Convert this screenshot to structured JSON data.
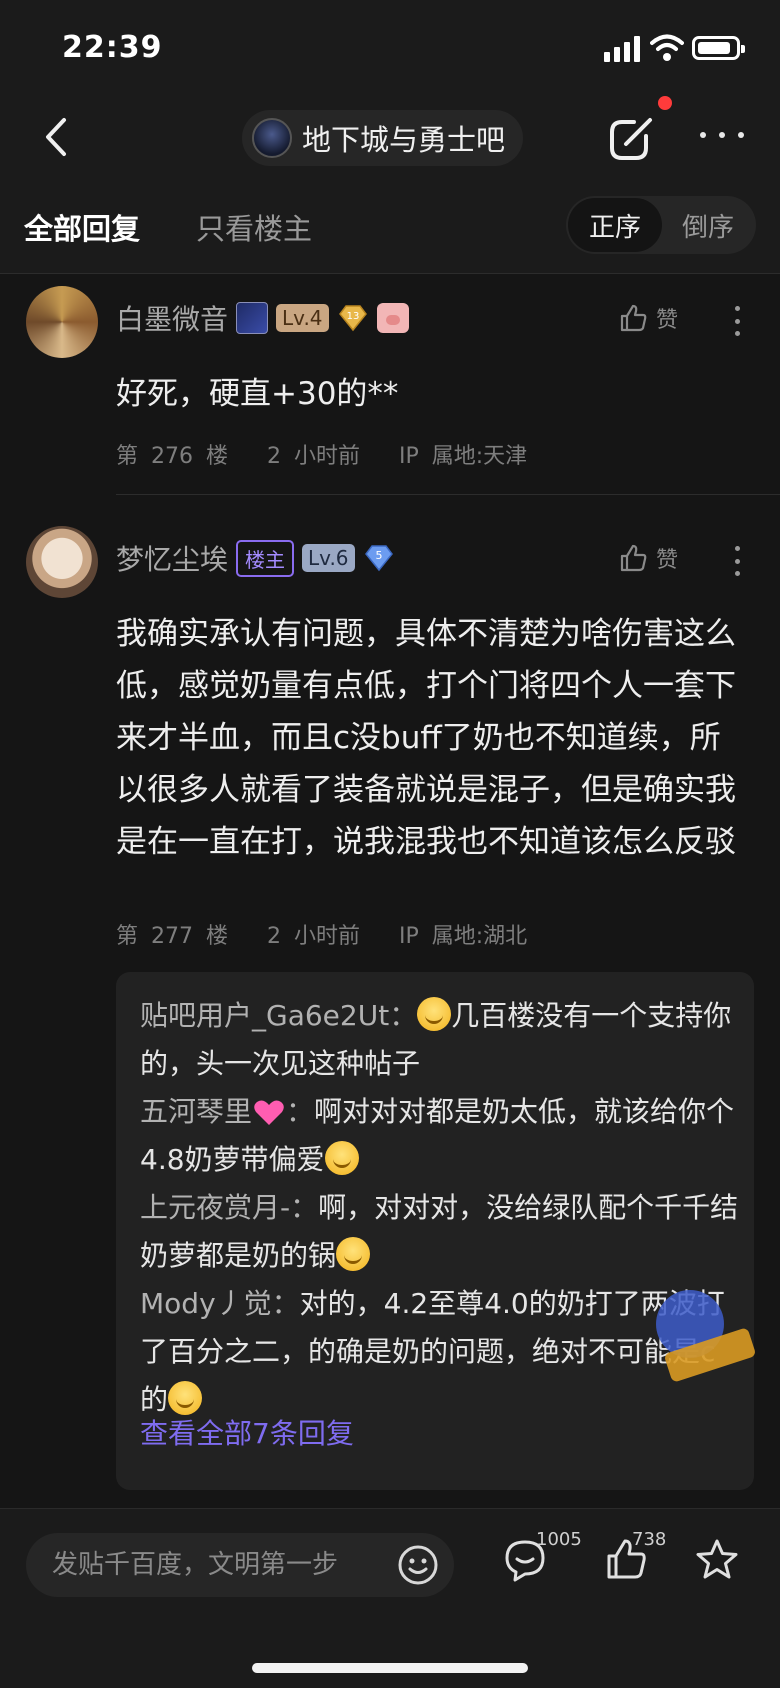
{
  "status_bar": {
    "time": "22:39"
  },
  "nav": {
    "forum_name": "地下城与勇士吧"
  },
  "tabs": {
    "all": "全部回复",
    "op_only": "只看楼主",
    "order_asc": "正序",
    "order_desc": "倒序"
  },
  "posts": [
    {
      "username": "白墨微音",
      "level": "Lv.4",
      "gem_level": "13",
      "content": "好死，硬直+30的**",
      "floor": "第 276 楼",
      "time": "2 小时前",
      "ip": "IP 属地:天津",
      "like_label": "赞"
    },
    {
      "username": "梦忆尘埃",
      "op_badge": "楼主",
      "level": "Lv.6",
      "gem_level": "5",
      "content": "我确实承认有问题，具体不清楚为啥伤害这么低，感觉奶量有点低，打个门将四个人一套下来才半血，而且c没buff了奶也不知道续，所以很多人就看了装备就说是混子，但是确实我是在一直在打，说我混我也不知道该怎么反驳",
      "floor": "第 277 楼",
      "time": "2 小时前",
      "ip": "IP 属地:湖北",
      "like_label": "赞",
      "replies": [
        {
          "name": "贴吧用户_Ga6e2Ut",
          "text": "几百楼没有一个支持你的，头一次见这种帖子"
        },
        {
          "name": "五河琴里",
          "text": "啊对对对都是奶太低，就该给你个4.8奶萝带偏爱"
        },
        {
          "name": "上元夜赏月-",
          "text": "啊，对对对，没给绿队配个千千结奶萝都是奶的锅"
        },
        {
          "name": "Mody丿觉",
          "text": "对的，4.2至尊4.0的奶打了两波打了百分之二，的确是奶的问题，绝对不可能是c的"
        }
      ],
      "view_all": "查看全部7条回复"
    }
  ],
  "bottom_bar": {
    "input_placeholder": "发贴千百度，文明第一步",
    "comment_count": "1005",
    "like_count": "738"
  },
  "colors": {
    "background": "#151515",
    "accent_purple": "#7f6cf0",
    "notification_dot": "#ff3b3b"
  },
  "icons": [
    "back-icon",
    "share-icon",
    "more-icon",
    "thumbs-up-icon",
    "kebab-icon",
    "smile-icon",
    "comment-icon",
    "star-icon"
  ]
}
